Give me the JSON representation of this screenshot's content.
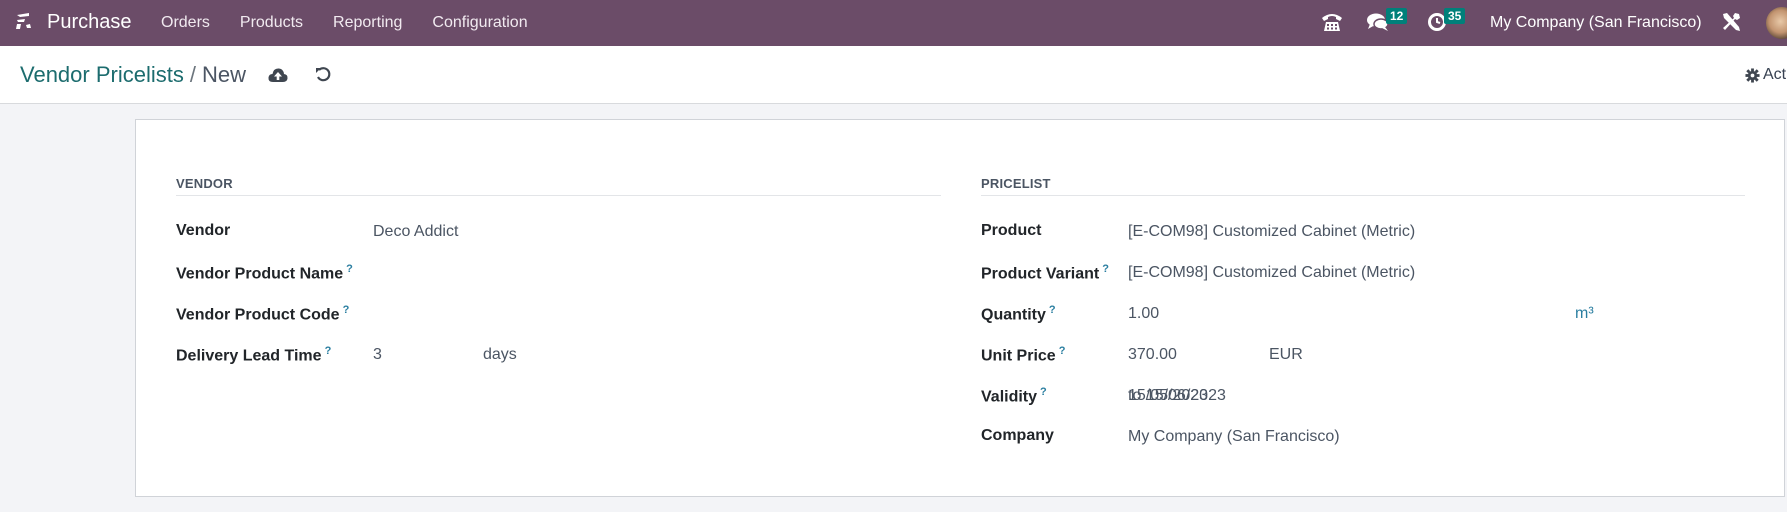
{
  "navbar": {
    "app_name": "Purchase",
    "menu": [
      "Orders",
      "Products",
      "Reporting",
      "Configuration"
    ],
    "icons": [
      "app-switcher-icon",
      "phone-icon",
      "chat-icon",
      "clock-icon",
      "tools-icon"
    ],
    "chat_count": "12",
    "activity_count": "35",
    "company": "My Company (San Francisco)",
    "accent": "#6b4c68",
    "badge_color": "#00807a"
  },
  "control_panel": {
    "breadcrumb_parent": "Vendor Pricelists",
    "breadcrumb_separator": "/",
    "breadcrumb_current": "New",
    "action_label": "Act"
  },
  "form": {
    "vendor_group": {
      "title": "VENDOR",
      "fields": {
        "vendor": {
          "label": "Vendor",
          "value": "Deco Addict"
        },
        "vendor_product_name": {
          "label": "Vendor Product Name",
          "tip": "?",
          "value": ""
        },
        "vendor_product_code": {
          "label": "Vendor Product Code",
          "tip": "?",
          "value": ""
        },
        "delivery_lead_time": {
          "label": "Delivery Lead Time",
          "tip": "?",
          "value": "3",
          "unit": "days"
        }
      }
    },
    "pricelist_group": {
      "title": "PRICELIST",
      "fields": {
        "product": {
          "label": "Product",
          "value": "[E-COM98] Customized Cabinet (Metric)"
        },
        "product_variant": {
          "label": "Product Variant",
          "tip": "?",
          "value": "[E-COM98] Customized Cabinet (Metric)"
        },
        "quantity": {
          "label": "Quantity",
          "tip": "?",
          "value": "1.00",
          "unit": "m³"
        },
        "unit_price": {
          "label": "Unit Price",
          "tip": "?",
          "value": "370.00",
          "currency": "EUR"
        },
        "validity": {
          "label": "Validity",
          "tip": "?",
          "date_start": "15/05/2023",
          "date_end": "to 15/06/2023"
        },
        "company": {
          "label": "Company",
          "value": "My Company (San Francisco)"
        }
      }
    }
  }
}
